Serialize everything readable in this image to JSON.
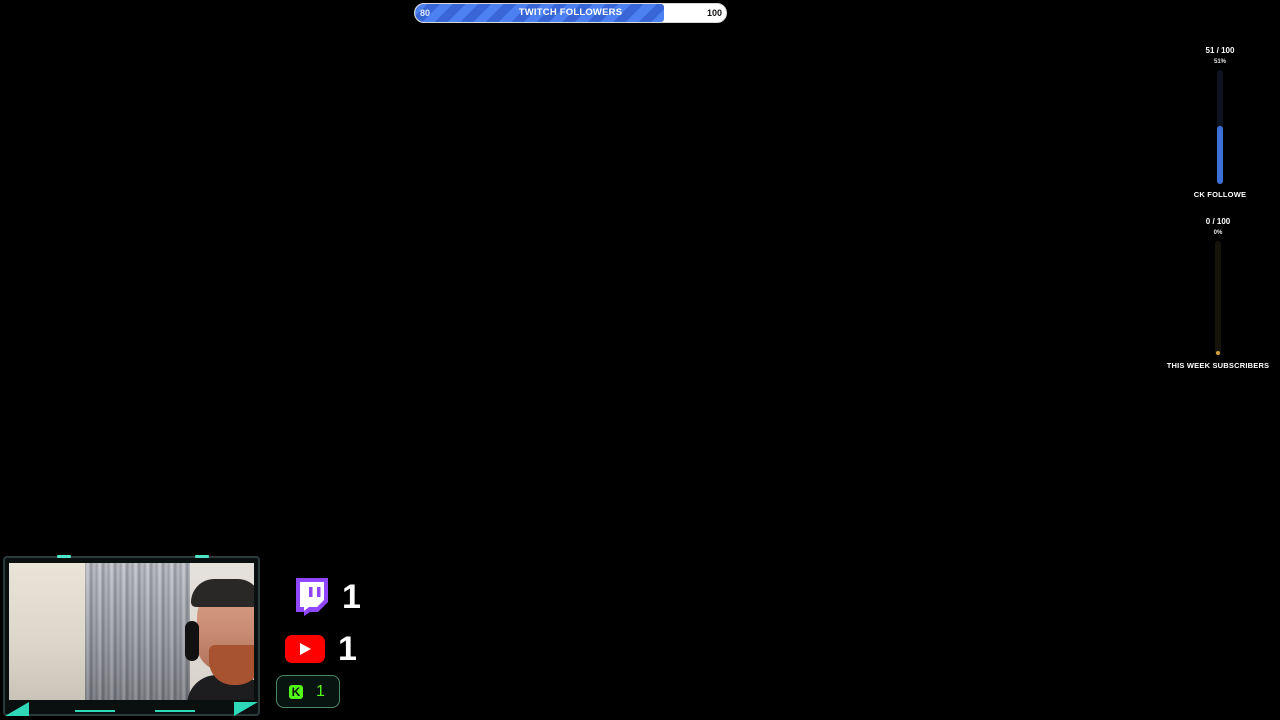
{
  "followers_bar": {
    "start": "80",
    "title": "TWITCH FOLLOWERS",
    "end": "100",
    "progress": 0.8,
    "fill_color": "#3f6fe0"
  },
  "goals": [
    {
      "count": "51 / 100",
      "percent": "51%",
      "label": "CK FOLLOWE",
      "progress": 0.51,
      "fill_color": "#3d6fd8",
      "track_color": "#0e1320"
    },
    {
      "count": "0 / 100",
      "percent": "0%",
      "label": "THIS WEEK SUBSCRIBERS",
      "progress": 0.0,
      "fill_color": "#d4a23a",
      "track_color": "#15130a"
    }
  ],
  "socials": {
    "twitch": {
      "icon": "twitch-icon",
      "count": "1",
      "color": "#9146ff"
    },
    "youtube": {
      "icon": "youtube-icon",
      "count": "1",
      "color": "#ff0000"
    },
    "kick": {
      "icon": "kick-icon",
      "icon_text": "K",
      "count": "1",
      "color": "#53fc18"
    }
  },
  "webcam": {
    "frame_accent": "#2fd9b8"
  }
}
